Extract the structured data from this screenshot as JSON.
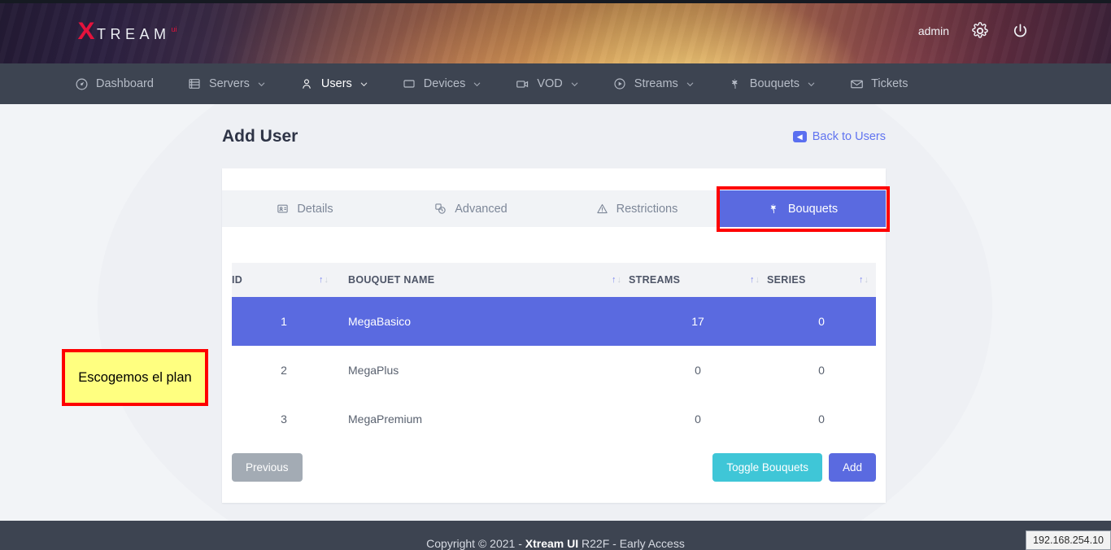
{
  "header": {
    "logo_x": "X",
    "logo_text": "TREAM",
    "logo_sup": "ui",
    "username": "admin",
    "settings_icon": "gear-icon",
    "power_icon": "power-icon"
  },
  "nav": {
    "items": [
      {
        "label": "Dashboard",
        "icon": "gauge-icon",
        "caret": false,
        "active": false
      },
      {
        "label": "Servers",
        "icon": "server-list-icon",
        "caret": true,
        "active": false
      },
      {
        "label": "Users",
        "icon": "user-icon",
        "caret": true,
        "active": true
      },
      {
        "label": "Devices",
        "icon": "device-icon",
        "caret": true,
        "active": false
      },
      {
        "label": "VOD",
        "icon": "video-icon",
        "caret": true,
        "active": false
      },
      {
        "label": "Streams",
        "icon": "play-circle-icon",
        "caret": true,
        "active": false
      },
      {
        "label": "Bouquets",
        "icon": "bouquet-icon",
        "caret": true,
        "active": false
      },
      {
        "label": "Tickets",
        "icon": "envelope-icon",
        "caret": false,
        "active": false
      }
    ]
  },
  "page": {
    "title": "Add User",
    "back_link": "Back to Users",
    "back_icon": "back-arrow-badge-icon"
  },
  "tabs": [
    {
      "label": "Details",
      "icon": "id-card-icon",
      "active": false
    },
    {
      "label": "Advanced",
      "icon": "timer-icon",
      "active": false
    },
    {
      "label": "Restrictions",
      "icon": "warning-icon",
      "active": false
    },
    {
      "label": "Bouquets",
      "icon": "bouquet-icon",
      "active": true
    }
  ],
  "table": {
    "columns": [
      {
        "key": "id",
        "label": "ID",
        "sort": "updown"
      },
      {
        "key": "name",
        "label": "BOUQUET NAME",
        "sort": "updown"
      },
      {
        "key": "streams",
        "label": "STREAMS",
        "sort": "updown"
      },
      {
        "key": "series",
        "label": "SERIES",
        "sort": "updown"
      }
    ],
    "sort_up_glyph": "↑",
    "sort_down_glyph": "↓",
    "rows": [
      {
        "id": "1",
        "name": "MegaBasico",
        "streams": "17",
        "series": "0",
        "selected": true
      },
      {
        "id": "2",
        "name": "MegaPlus",
        "streams": "0",
        "series": "0",
        "selected": false
      },
      {
        "id": "3",
        "name": "MegaPremium",
        "streams": "0",
        "series": "0",
        "selected": false
      }
    ]
  },
  "actions": {
    "previous": "Previous",
    "toggle_bouquets": "Toggle Bouquets",
    "add": "Add"
  },
  "annotation": {
    "text": "Escogemos el plan",
    "fill": "#ffff80",
    "border": "#fe0000"
  },
  "footer": {
    "prefix": "Copyright © 2021 - ",
    "brand": "Xtream UI",
    "suffix": " R22F - Early Access"
  },
  "status_tooltip": {
    "ip": "192.168.254.10"
  },
  "colors": {
    "accent_blue": "#5a6ae0",
    "teal": "#3fc6d7",
    "gray_btn": "#a3abb4",
    "nav_bg": "#3d4451",
    "page_bg": "#f2f4f7",
    "logo_red": "#e5123c",
    "annotation_red": "#fe0000"
  }
}
